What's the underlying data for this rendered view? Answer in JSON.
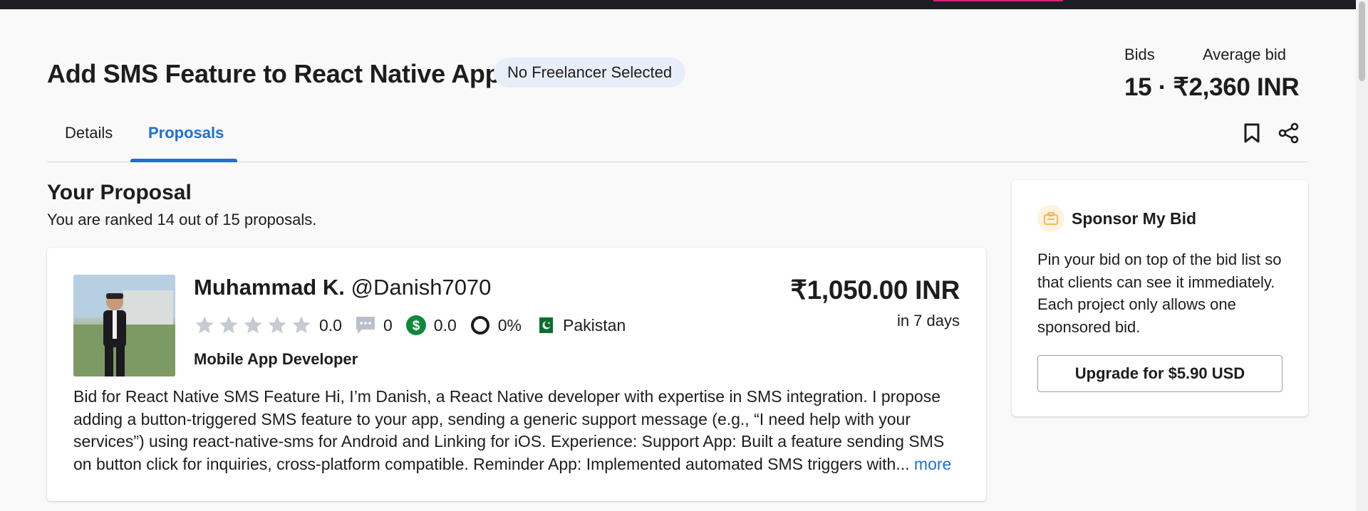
{
  "header": {
    "title": "Add SMS Feature to React Native App",
    "status_badge": "No Freelancer Selected"
  },
  "stats": {
    "bids_label": "Bids",
    "average_bid_label": "Average bid",
    "summary": "15 · ₹2,360 INR"
  },
  "tabs": [
    {
      "label": "Details",
      "active": false
    },
    {
      "label": "Proposals",
      "active": true
    }
  ],
  "actions": {
    "bookmark_icon": "bookmark-icon",
    "share_icon": "share-icon"
  },
  "proposal_section": {
    "title": "Your Proposal",
    "rank_text": "You are ranked 14 out of 15 proposals."
  },
  "proposal": {
    "name": "Muhammad K.",
    "username": "@Danish7070",
    "rating": "0.0",
    "reviews": "0",
    "earnings_score": "0.0",
    "completion": "0%",
    "country": "Pakistan",
    "role": "Mobile App Developer",
    "price": "₹1,050.00 INR",
    "delivery": "in 7 days",
    "description": "Bid for React Native SMS Feature Hi, I’m Danish, a React Native developer with expertise in SMS integration. I propose adding a button-triggered SMS feature to your app, sending a generic support message (e.g., “I need help with your services”) using react-native-sms for Android and Linking for iOS. Experience: Support App: Built a feature sending SMS on button click for inquiries, cross-platform compatible. Reminder App: Implemented automated SMS triggers with...",
    "more_label": "more",
    "colors": {
      "star": "#c5cad3",
      "money_badge": "#0e8a3a",
      "link": "#1f6fd1"
    }
  },
  "sponsor": {
    "title": "Sponsor My Bid",
    "text": "Pin your bid on top of the bid list so that clients can see it immediately. Each project only allows one sponsored bid.",
    "button_label": "Upgrade for $5.90 USD"
  }
}
